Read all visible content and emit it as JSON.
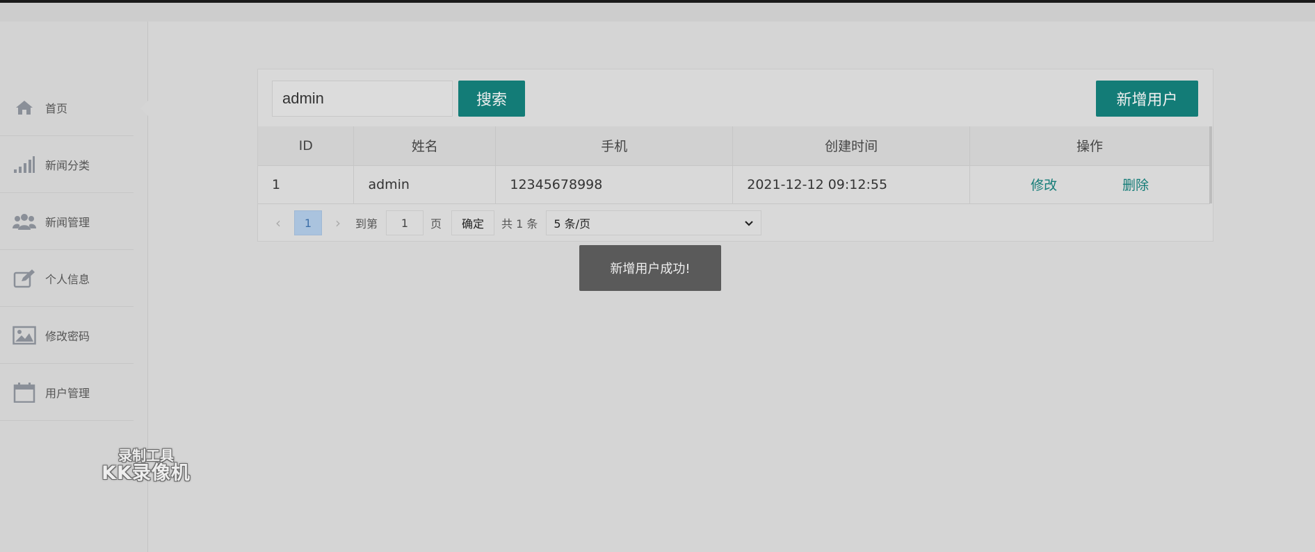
{
  "sidebar": {
    "items": [
      {
        "label": "首页",
        "icon": "home-icon"
      },
      {
        "label": "新闻分类",
        "icon": "signal-bars-icon"
      },
      {
        "label": "新闻管理",
        "icon": "users-icon"
      },
      {
        "label": "个人信息",
        "icon": "edit-icon"
      },
      {
        "label": "修改密码",
        "icon": "image-icon"
      },
      {
        "label": "用户管理",
        "icon": "calendar-icon"
      }
    ]
  },
  "toolbar": {
    "search_value": "admin",
    "search_button": "搜索",
    "add_button": "新增用户"
  },
  "table": {
    "headers": [
      "ID",
      "姓名",
      "手机",
      "创建时间",
      "操作"
    ],
    "rows": [
      {
        "id": "1",
        "name": "admin",
        "phone": "12345678998",
        "created": "2021-12-12 09:12:55",
        "edit": "修改",
        "delete": "删除"
      }
    ]
  },
  "pager": {
    "current": "1",
    "goto_label": "到第",
    "goto_value": "1",
    "page_unit": "页",
    "confirm": "确定",
    "total": "共 1 条",
    "page_size": "5 条/页"
  },
  "toast": "新增用户成功!",
  "watermark": {
    "line1": "录制工具",
    "line2": "KK录像机"
  },
  "colors": {
    "accent": "#137c77",
    "page_active": "#aac3de"
  }
}
